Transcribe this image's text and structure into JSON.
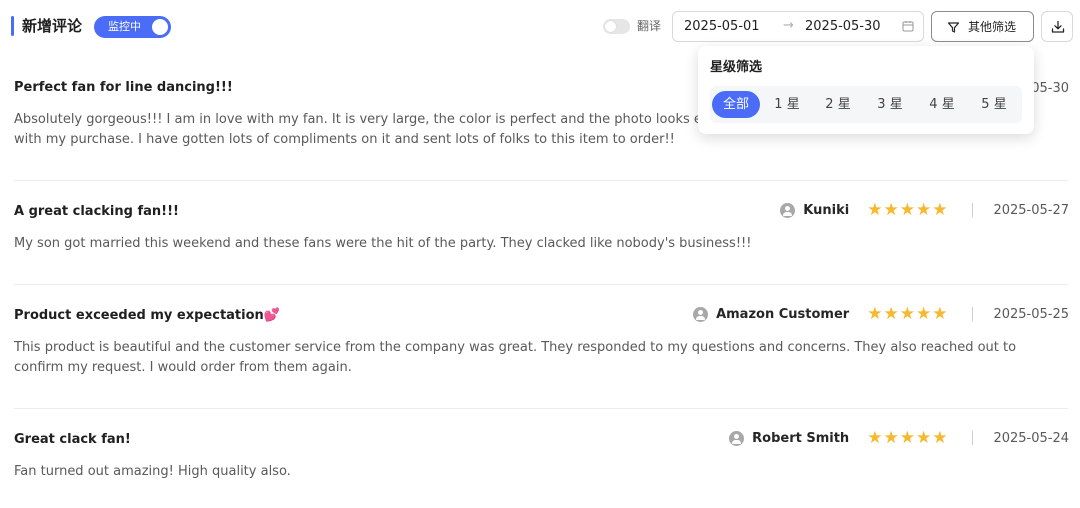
{
  "header": {
    "title": "新增评论",
    "monitor_label": "监控中",
    "translate_label": "翻译",
    "date_start": "2025-05-01",
    "date_arrow": "→",
    "date_end": "2025-05-30",
    "filter_label": "其他筛选"
  },
  "popover": {
    "title": "星级筛选",
    "options": [
      "全部",
      "1 星",
      "2 星",
      "3 星",
      "4 星",
      "5 星"
    ],
    "selected": "全部"
  },
  "reviews": [
    {
      "title": "Perfect fan for line dancing!!!",
      "body": "Absolutely gorgeous!!! I am in love with my fan. It is very large, the color is perfect and the photo looks exactly like the product I received. I am so happy with my purchase. I have gotten lots of compliments on it and sent lots of folks to this item to order!!",
      "author": "",
      "rating": 5,
      "date": "2025-05-30"
    },
    {
      "title": "A great clacking fan!!!",
      "body": "My son got married this weekend and these fans were the hit of the party. They clacked like nobody's business!!!",
      "author": "Kuniki",
      "rating": 5,
      "date": "2025-05-27"
    },
    {
      "title": "Product exceeded my expectation💕",
      "body": "This product is beautiful and the customer service from the company was great. They responded to my questions and concerns. They also reached out to confirm my request. I would order from them again.",
      "author": "Amazon Customer",
      "rating": 5,
      "date": "2025-05-25"
    },
    {
      "title": "Great clack fan!",
      "body": "Fan turned out amazing! High quality also.",
      "author": "Robert Smith",
      "rating": 5,
      "date": "2025-05-24"
    }
  ],
  "colors": {
    "accent": "#4a6cf7",
    "star": "#f5b82e"
  },
  "icons": [
    "calendar-icon",
    "filter-icon",
    "download-icon",
    "avatar-icon",
    "star-icon"
  ]
}
